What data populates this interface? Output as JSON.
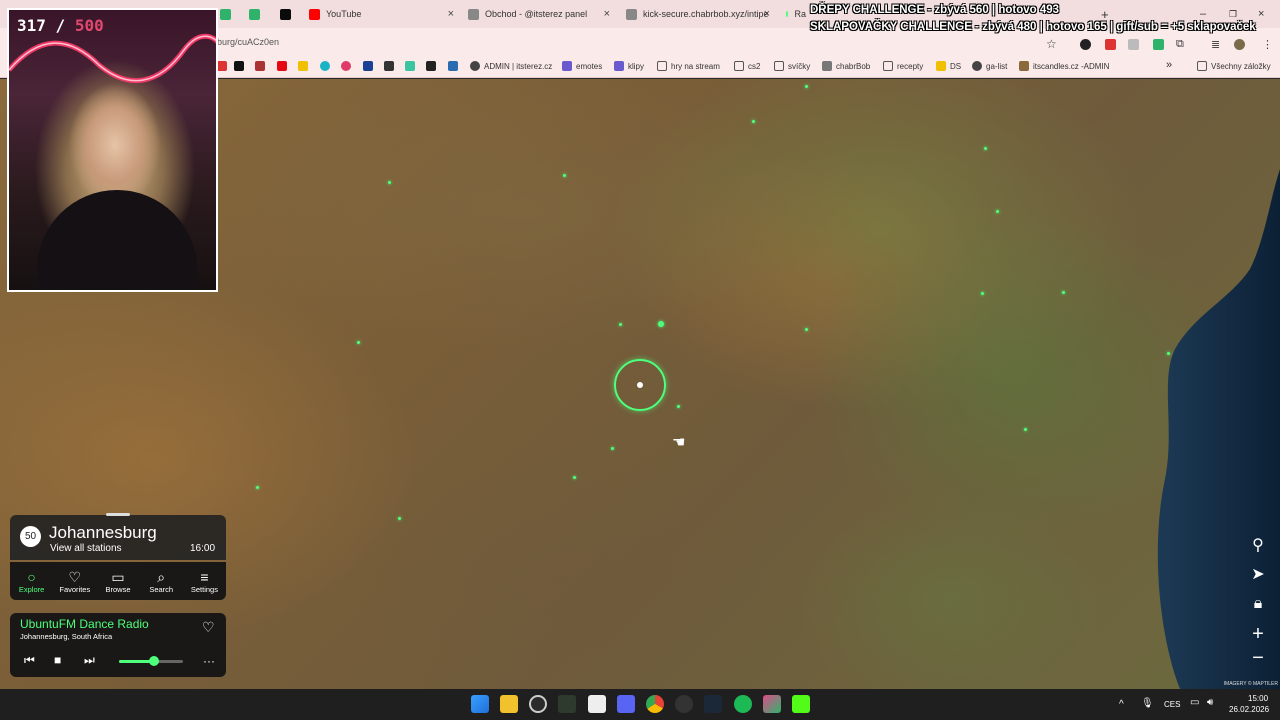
{
  "browser": {
    "tabs": [
      {
        "label": "",
        "color": "#2fb36b"
      },
      {
        "label": "",
        "color": "#2fb36b"
      },
      {
        "label": "",
        "color": "#0b0b0b"
      },
      {
        "label": "YouTube",
        "color": "#ff0000"
      },
      {
        "label": "Obchod - @itsterez panel",
        "color": "#888888"
      },
      {
        "label": "kick-secure.chabrbob.xyz/intipe",
        "color": "#888888"
      },
      {
        "label": "Ra",
        "color": "#4dff7a"
      }
    ],
    "url": "burg/cuACz0en",
    "bookmarks": [
      "ADMIN | itsterez.cz",
      "emotes",
      "klipy",
      "hry na stream",
      "cs2",
      "svíčky",
      "chabrBob",
      "recepty",
      "DS",
      "ga-list",
      "itscandles.cz -ADMIN",
      "Všechny záložky"
    ]
  },
  "overlay": {
    "challenge_line1": "DŘEPY CHALLENGE - zbývá 560 | hotovo 493",
    "challenge_line2": "SKLAPOVAČKY CHALLENGE - zbývá 480 | hotovo 165 | gift/sub = +5 sklapovaček",
    "counter_current": "317",
    "counter_sep": " / ",
    "counter_total": "500"
  },
  "radio": {
    "station_count": "50",
    "city": "Johannesburg",
    "view_all": "View all stations",
    "local_time": "16:00",
    "nav": [
      {
        "label": "Explore",
        "icon": "explore-icon",
        "glyph": "○",
        "active": true
      },
      {
        "label": "Favorites",
        "icon": "heart-icon",
        "glyph": "♡",
        "active": false
      },
      {
        "label": "Browse",
        "icon": "map-book-icon",
        "glyph": "▭",
        "active": false
      },
      {
        "label": "Search",
        "icon": "search-icon",
        "glyph": "⌕",
        "active": false
      },
      {
        "label": "Settings",
        "icon": "menu-icon",
        "glyph": "≡",
        "active": false
      }
    ],
    "now_playing": "UbuntuFM Dance Radio",
    "location": "Johannesburg, South Africa",
    "volume": 0.55
  },
  "map": {
    "attribution": "IMAGERY © MAPTILER"
  },
  "taskbar": {
    "language": "CES",
    "time": "15:00",
    "date": "26.02.2026"
  },
  "colors": {
    "accent": "#4dff7a",
    "counter_total": "#e0486d"
  }
}
